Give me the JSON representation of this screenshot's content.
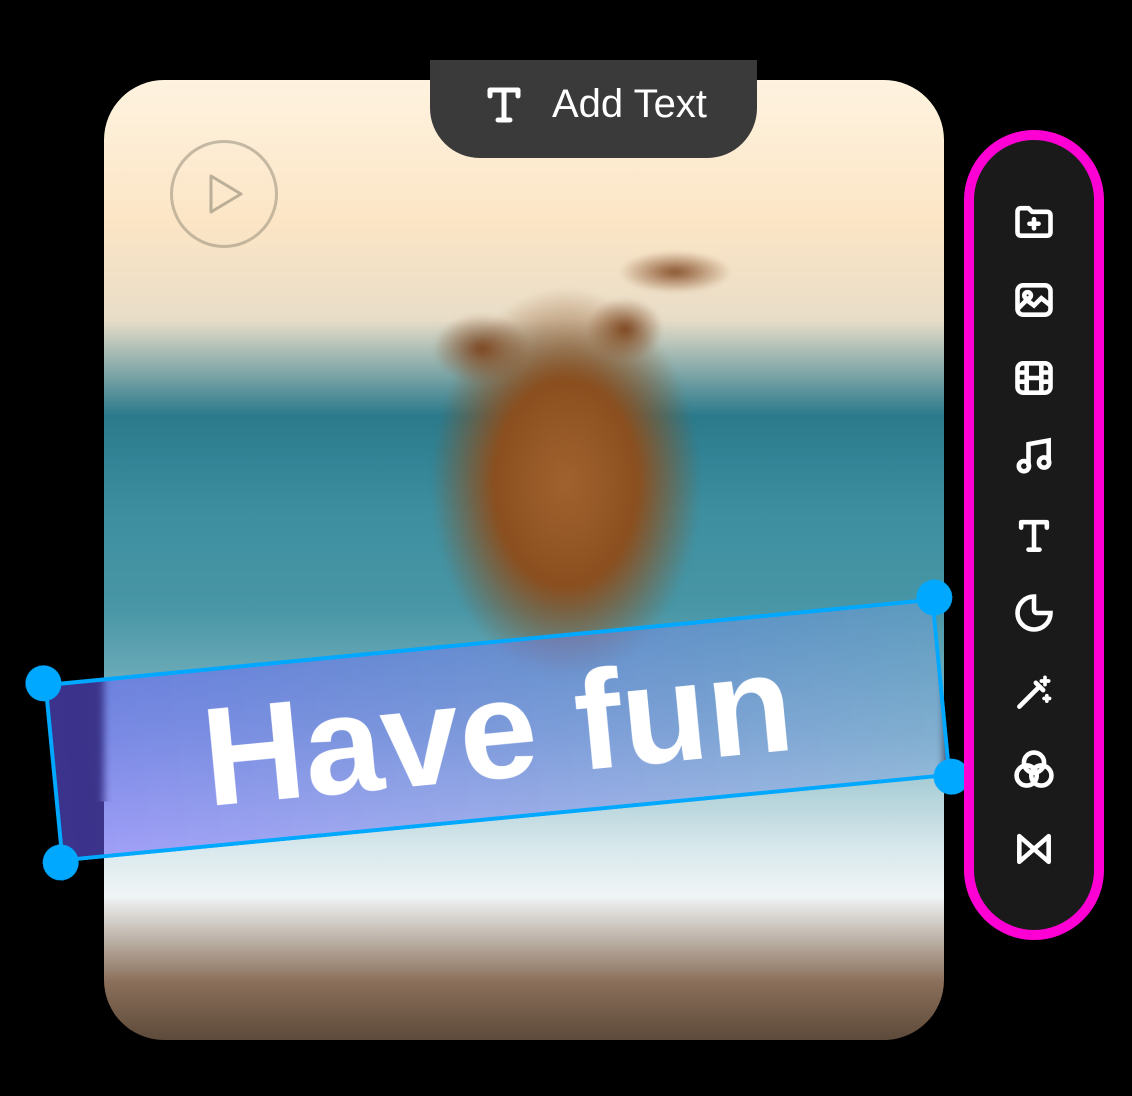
{
  "floating_action": {
    "label": "Add Text",
    "icon": "text-icon"
  },
  "canvas": {
    "text_overlay": "Have fun",
    "play_icon": "play-icon",
    "selection": {
      "border_color": "#00a8ff",
      "handle_color": "#00a8ff",
      "rotation_degrees": -5.5
    }
  },
  "toolbar": {
    "highlight_color": "#ff00d4",
    "items": [
      {
        "name": "add-folder-icon"
      },
      {
        "name": "image-icon"
      },
      {
        "name": "video-icon"
      },
      {
        "name": "music-icon"
      },
      {
        "name": "text-icon"
      },
      {
        "name": "sticker-icon"
      },
      {
        "name": "magic-wand-icon"
      },
      {
        "name": "filter-icon"
      },
      {
        "name": "transition-icon"
      }
    ]
  }
}
